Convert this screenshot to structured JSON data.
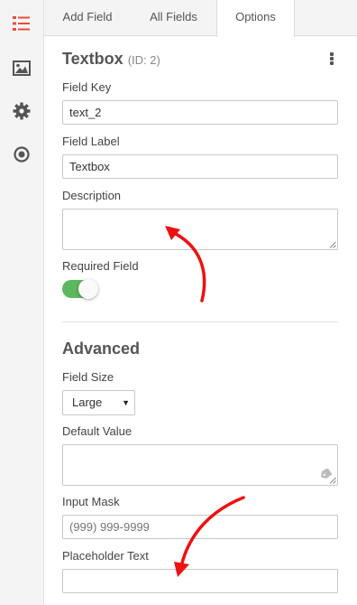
{
  "rail": {
    "icons": [
      "list-icon",
      "image-icon",
      "gear-icon",
      "radio-target-icon"
    ],
    "active_color": "#e74c3c",
    "icon_color": "#555555"
  },
  "tabs": [
    {
      "label": "Add Field",
      "active": false
    },
    {
      "label": "All Fields",
      "active": false
    },
    {
      "label": "Options",
      "active": true
    }
  ],
  "field": {
    "title": "Textbox",
    "id_text": "(ID: 2)"
  },
  "form": {
    "field_key_label": "Field Key",
    "field_key_value": "text_2",
    "field_label_label": "Field Label",
    "field_label_value": "Textbox",
    "description_label": "Description",
    "description_value": "",
    "required_label": "Required Field",
    "required_on": true
  },
  "advanced": {
    "heading": "Advanced",
    "field_size_label": "Field Size",
    "field_size_value": "Large",
    "default_value_label": "Default Value",
    "default_value": "",
    "input_mask_label": "Input Mask",
    "input_mask_placeholder": "(999) 999-9999",
    "placeholder_label": "Placeholder Text",
    "placeholder_value": ""
  },
  "colors": {
    "toggle_on": "#5cb85c",
    "annotation_arrow": "#ee1111"
  }
}
